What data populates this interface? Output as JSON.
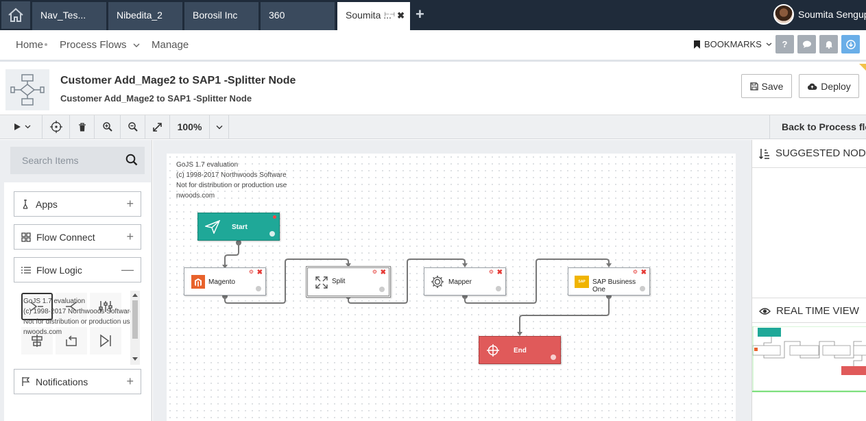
{
  "tabs": {
    "home_icon": "home-icon",
    "items": [
      {
        "label": "Nav_Tes..."
      },
      {
        "label": "Nibedita_2"
      },
      {
        "label": "Borosil Inc"
      },
      {
        "label": "360"
      },
      {
        "label": "Soumita ..."
      }
    ],
    "close_label": "✖",
    "add_label": "+"
  },
  "user": {
    "name": "Soumita Sengupta"
  },
  "nav": {
    "home": "Home",
    "process_flows": "Process Flows",
    "manage": "Manage",
    "bookmarks": "BOOKMARKS"
  },
  "header": {
    "title": "Customer Add_Mage2 to SAP1 -Splitter Node",
    "subtitle": "Customer Add_Mage2 to SAP1 -Splitter Node",
    "save": "Save",
    "deploy": "Deploy"
  },
  "toolbar": {
    "zoom": "100%",
    "back": "Back to Process flow"
  },
  "left_panel": {
    "search_placeholder": "Search Items",
    "sections": [
      {
        "label": "Apps",
        "sign": "+"
      },
      {
        "label": "Flow Connect",
        "sign": "+"
      },
      {
        "label": "Flow Logic",
        "sign": "—"
      },
      {
        "label": "Notifications",
        "sign": "+"
      }
    ],
    "palette_watermark": [
      "GoJS 1.7 evaluation",
      "(c) 1998-2017 Northwoods Software",
      "Not for distribution or production use",
      "nwoods.com"
    ]
  },
  "canvas": {
    "watermark": [
      "GoJS 1.7 evaluation",
      "(c) 1998-2017 Northwoods Software",
      "Not for distribution or production use",
      "nwoods.com"
    ],
    "nodes": {
      "start": "Start",
      "magento": "Magento",
      "split": "Split",
      "mapper": "Mapper",
      "sap": "SAP Business One",
      "end": "End"
    },
    "colors": {
      "start": "#1fa898",
      "end": "#e05a5a",
      "magento": "#e8622c",
      "sap": "#f0b400"
    }
  },
  "right_panel": {
    "suggested": "SUGGESTED NODES",
    "realtime": "REAL TIME VIEW"
  }
}
